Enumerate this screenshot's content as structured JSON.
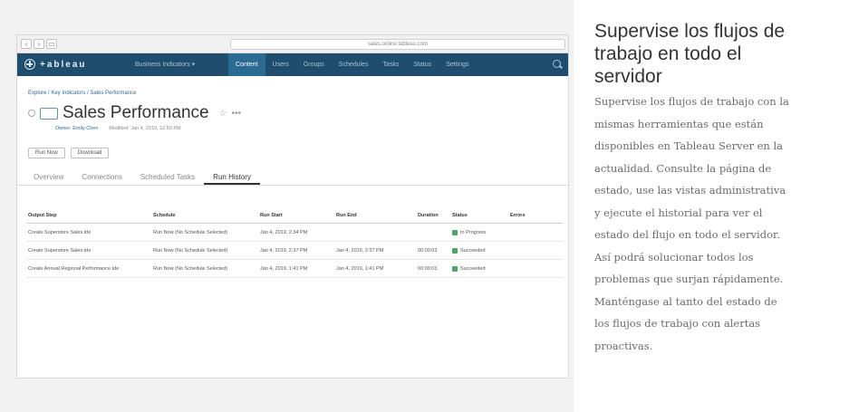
{
  "browser": {
    "nav_buttons": [
      "‹",
      "›",
      "▭"
    ],
    "url": "sales.online.tableau.com"
  },
  "app": {
    "logo_text": "+ableau",
    "site_menu": "Business Indicators ▾",
    "nav": [
      {
        "label": "Content",
        "active": true
      },
      {
        "label": "Users",
        "active": false
      },
      {
        "label": "Groups",
        "active": false
      },
      {
        "label": "Schedules",
        "active": false
      },
      {
        "label": "Tasks",
        "active": false
      },
      {
        "label": "Status",
        "active": false
      },
      {
        "label": "Settings",
        "active": false
      }
    ]
  },
  "page": {
    "breadcrumb": "Explore / Key Indicators / Sales Performance",
    "title": "Sales Performance",
    "star": "☆",
    "more": "•••",
    "owner_label": "Owner: Emily Chen",
    "modified_label": "Modified: Jan 4, 2019, 12:50 PM",
    "actions": [
      "Run Now",
      "Download"
    ],
    "tabs": [
      {
        "label": "Overview",
        "active": false
      },
      {
        "label": "Connections",
        "active": false
      },
      {
        "label": "Scheduled Tasks",
        "active": false
      },
      {
        "label": "Run History",
        "active": true
      }
    ]
  },
  "table": {
    "columns": [
      "Output Step",
      "Schedule",
      "Run Start",
      "Run End",
      "Duration",
      "Status",
      "Errors"
    ],
    "rows": [
      [
        "Create Superstore Sales.tde",
        "Run Now (No Schedule Selected)",
        "Jan 4, 2019, 2:34 PM",
        "",
        "",
        "In Progress",
        ""
      ],
      [
        "Create Superstore Sales.tde",
        "Run Now (No Schedule Selected)",
        "Jan 4, 2019, 2:37 PM",
        "Jan 4, 2019, 2:37 PM",
        "00:00:03",
        "Succeeded",
        ""
      ],
      [
        "Create Annual Regional Performance.tde",
        "Run Now (No Schedule Selected)",
        "Jan 4, 2019, 1:41 PM",
        "Jan 4, 2019, 1:41 PM",
        "00:00:03",
        "Succeeded",
        ""
      ]
    ],
    "status_colors": {
      "In Progress": "#4fa36b",
      "Succeeded": "#4fa36b"
    }
  },
  "side": {
    "heading_lines": [
      "Supervise los flujos de",
      "trabajo en todo el",
      "servidor"
    ],
    "desc_lines": [
      "Supervise los flujos de trabajo con la",
      "mismas herramientas que están",
      "disponibles en Tableau Server en la",
      "actualidad. Consulte la página de",
      "estado, use las vistas administrativa",
      "y ejecute el historial para ver el",
      "estado del flujo en todo el servidor.",
      "Así podrá solucionar todos los",
      "problemas que surjan rápidamente.",
      "Manténgase al tanto del estado de",
      "los flujos de trabajo con alertas",
      "proactivas."
    ]
  },
  "colors": {
    "appbar": "#1f4d6e",
    "nav_active": "#2b6a92",
    "link": "#2b6a92"
  }
}
